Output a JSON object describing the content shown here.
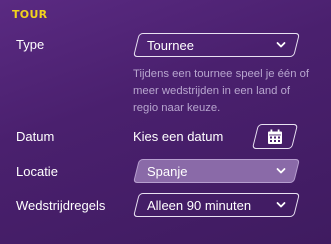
{
  "section": {
    "title": "TOUR"
  },
  "fields": {
    "type": {
      "label": "Type",
      "value": "Tournee"
    },
    "description": "Tijdens een tournee speel je één of meer wedstrijden in een land of regio naar keuze.",
    "date": {
      "label": "Datum",
      "value": "Kies een datum",
      "icon": "calendar-icon"
    },
    "location": {
      "label": "Locatie",
      "value": "Spanje"
    },
    "rules": {
      "label": "Wedstrijdregels",
      "value": "Alleen 90 minuten"
    }
  },
  "colors": {
    "accent": "#f2d31b",
    "background": "#4a206e",
    "muted_text": "#b8a6cf",
    "selected_field": "#8a6aa8"
  },
  "icons": {
    "dropdown": "chevron-down-icon"
  }
}
